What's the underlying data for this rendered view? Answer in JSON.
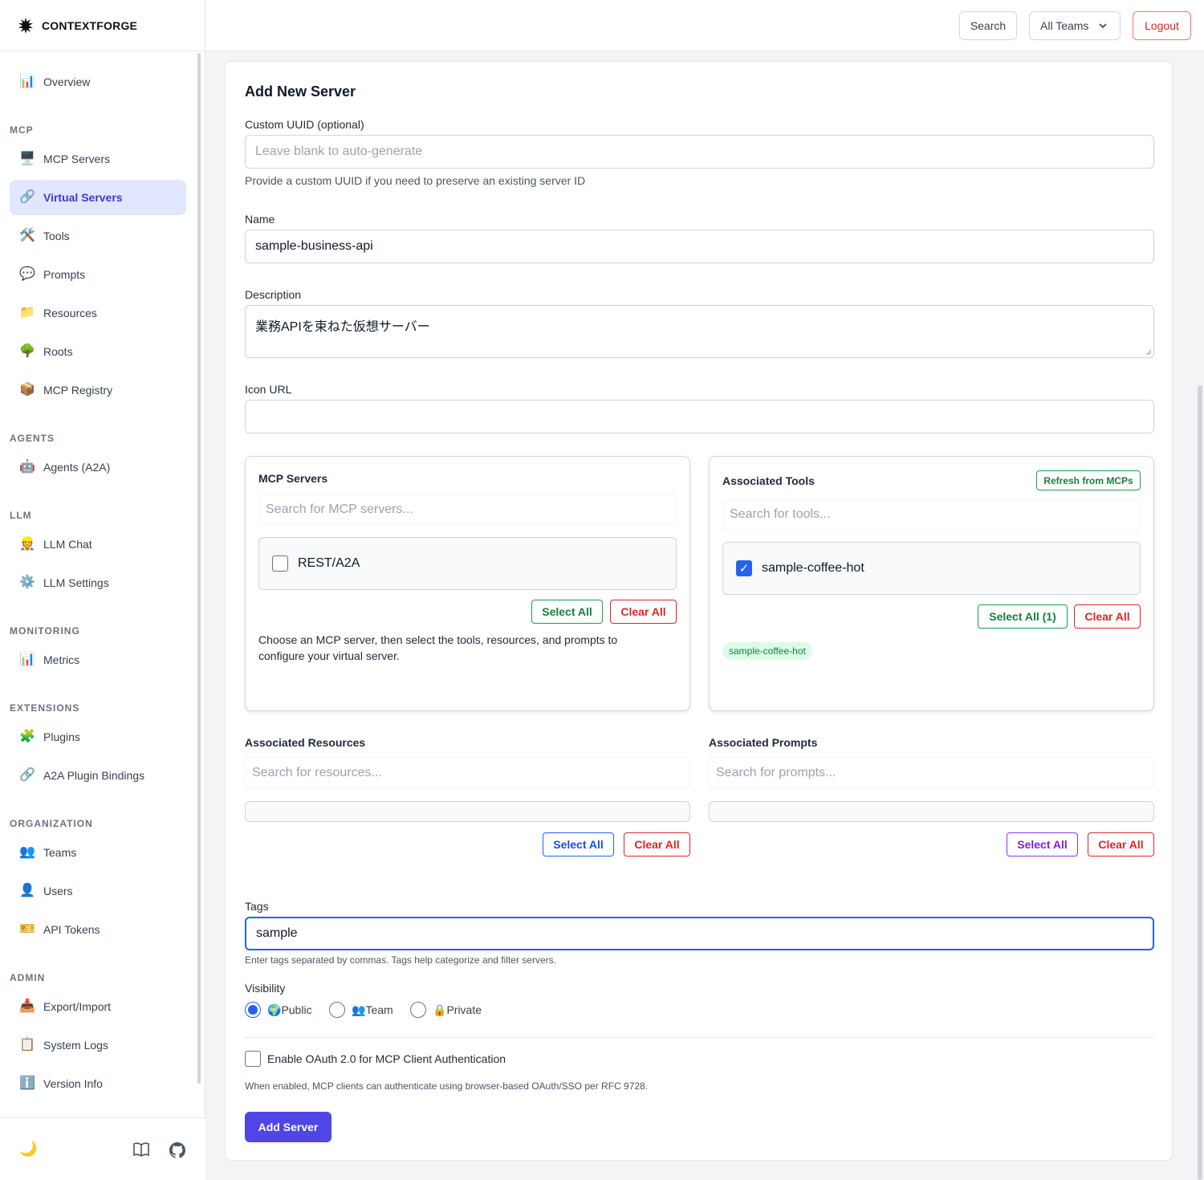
{
  "brand": {
    "name": "CONTEXTFORGE"
  },
  "topbar": {
    "search": "Search",
    "teams": "All Teams",
    "logout": "Logout"
  },
  "sidebar": {
    "overview": "Overview",
    "sections": {
      "mcp": "MCP",
      "agents": "AGENTS",
      "llm": "LLM",
      "monitoring": "MONITORING",
      "extensions": "EXTENSIONS",
      "organization": "ORGANIZATION",
      "admin": "ADMIN"
    },
    "items": {
      "mcp_servers": "MCP Servers",
      "virtual_servers": "Virtual Servers",
      "tools": "Tools",
      "prompts": "Prompts",
      "resources": "Resources",
      "roots": "Roots",
      "mcp_registry": "MCP Registry",
      "agents": "Agents (A2A)",
      "llm_chat": "LLM Chat",
      "llm_settings": "LLM Settings",
      "metrics": "Metrics",
      "plugins": "Plugins",
      "a2a_bindings": "A2A Plugin Bindings",
      "teams": "Teams",
      "users": "Users",
      "api_tokens": "API Tokens",
      "export_import": "Export/Import",
      "system_logs": "System Logs",
      "version_info": "Version Info"
    },
    "active": "virtual_servers"
  },
  "form": {
    "title": "Add New Server",
    "uuid": {
      "label": "Custom UUID (optional)",
      "placeholder": "Leave blank to auto-generate",
      "help": "Provide a custom UUID if you need to preserve an existing server ID"
    },
    "name": {
      "label": "Name",
      "value": "sample-business-api"
    },
    "description": {
      "label": "Description",
      "value": "業務APIを束ねた仮想サーバー"
    },
    "icon_url": {
      "label": "Icon URL",
      "value": ""
    },
    "mcp_servers": {
      "label": "MCP Servers",
      "search_placeholder": "Search for MCP servers...",
      "options": [
        {
          "label": "REST/A2A",
          "checked": false
        }
      ],
      "select_all": "Select All",
      "clear_all": "Clear All",
      "help": "Choose an MCP server, then select the tools, resources, and prompts to configure your virtual server."
    },
    "tools": {
      "label": "Associated Tools",
      "refresh": "Refresh from MCPs",
      "search_placeholder": "Search for tools...",
      "options": [
        {
          "label": "sample-coffee-hot",
          "checked": true
        }
      ],
      "select_all": "Select All (1)",
      "clear_all": "Clear All",
      "selected_pills": [
        "sample-coffee-hot"
      ]
    },
    "resources": {
      "label": "Associated Resources",
      "search_placeholder": "Search for resources...",
      "select_all": "Select All",
      "clear_all": "Clear All"
    },
    "prompts": {
      "label": "Associated Prompts",
      "search_placeholder": "Search for prompts...",
      "select_all": "Select All",
      "clear_all": "Clear All"
    },
    "tags": {
      "label": "Tags",
      "value": "sample",
      "help": "Enter tags separated by commas. Tags help categorize and filter servers."
    },
    "visibility": {
      "label": "Visibility",
      "options": [
        {
          "icon": "🌍",
          "label": "Public",
          "selected": true
        },
        {
          "icon": "👥",
          "label": "Team",
          "selected": false
        },
        {
          "icon": "🔒",
          "label": "Private",
          "selected": false
        }
      ]
    },
    "oauth": {
      "label": "Enable OAuth 2.0 for MCP Client Authentication",
      "checked": false,
      "help": "When enabled, MCP clients can authenticate using browser-based OAuth/SSO per RFC 9728."
    },
    "submit": "Add Server"
  },
  "colors": {
    "accent": "#4f46e5",
    "active_bg": "#e0e7ff",
    "danger": "#dc2626",
    "success": "#16a34a",
    "focus": "#2563eb"
  }
}
